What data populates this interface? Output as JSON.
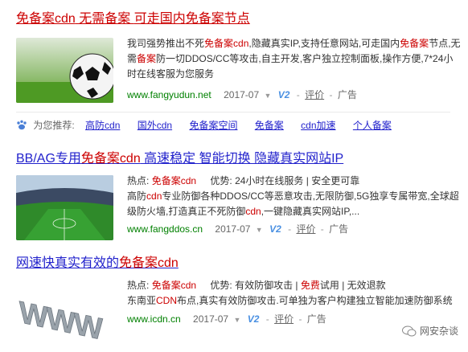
{
  "results": [
    {
      "title_parts": [
        {
          "t": "免备案cdn",
          "red": true
        },
        {
          "t": " 无需备案 ",
          "red": false
        },
        {
          "t": "可走国内",
          "red": false
        },
        {
          "t": "免备案",
          "red": true
        },
        {
          "t": "节点",
          "red": false
        }
      ],
      "desc": [
        {
          "t": "我司强势推出不死",
          "red": false
        },
        {
          "t": "免备案cdn",
          "red": true
        },
        {
          "t": ",隐藏真实IP,支持任意网站,可走国内",
          "red": false
        },
        {
          "t": "免备案",
          "red": true
        },
        {
          "t": "节点,无需",
          "red": false
        },
        {
          "t": "备案",
          "red": true
        },
        {
          "t": "防一切DDOS/CC等攻击,自主开发,客户独立控制面板,操作方便,7*24小时在线客服为您服务",
          "red": false
        }
      ],
      "url": "www.fangyudun.net",
      "date": "2017-07",
      "rating": "评价",
      "ad": "广告"
    },
    {
      "title_parts": [
        {
          "t": "BB/AG专用",
          "red": false
        },
        {
          "t": "免备案cdn",
          "red": true
        },
        {
          "t": " 高速稳定 智能切换 隐藏真实网站IP",
          "red": false
        }
      ],
      "hot_label": "热点:",
      "hot_kw": "免备案cdn",
      "adv_label": "优势:",
      "adv_text": "24小时在线服务 | 安全更可靠",
      "desc": [
        {
          "t": "高防",
          "red": false
        },
        {
          "t": "cdn",
          "red": true
        },
        {
          "t": "专业防御各种DDOS/CC等恶意攻击,无限防御,5G独享专属带宽,全球超级防火墙,打造真正不死防御",
          "red": false
        },
        {
          "t": "cdn",
          "red": true
        },
        {
          "t": ",一键隐藏真实网站IP,...",
          "red": false
        }
      ],
      "url": "www.fangddos.cn",
      "date": "2017-07",
      "rating": "评价",
      "ad": "广告"
    },
    {
      "title_parts": [
        {
          "t": "网速快真实有效的",
          "red": false
        },
        {
          "t": "免备案cdn",
          "red": true
        }
      ],
      "hot_label": "热点:",
      "hot_kw": "免备案cdn",
      "adv_label": "优势:",
      "adv_text_1": "有效防御攻击 | ",
      "adv_free": "免费",
      "adv_text_2": "试用 | 无效退款",
      "desc": [
        {
          "t": "东南亚",
          "red": false
        },
        {
          "t": "CDN",
          "red": true
        },
        {
          "t": "布点,真实有效防御攻击.可单独为客户构建独立智能加速防御系统",
          "red": false
        }
      ],
      "url": "www.icdn.cn",
      "date": "2017-07",
      "rating": "评价",
      "ad": "广告"
    }
  ],
  "recommend": {
    "label": "为您推荐:",
    "links": [
      "高防cdn",
      "国外cdn",
      "免备案空间",
      "免备案",
      "cdn加速",
      "个人备案"
    ]
  },
  "v2": "V2",
  "watermark": "网安杂谈"
}
